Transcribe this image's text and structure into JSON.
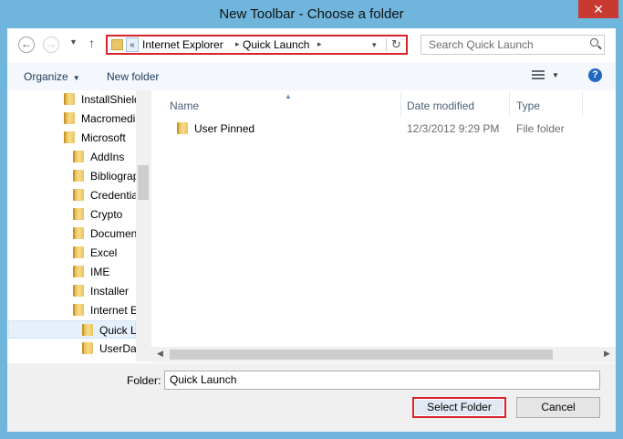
{
  "window": {
    "title": "New Toolbar - Choose a folder",
    "close_glyph": "✕"
  },
  "nav": {
    "back_glyph": "←",
    "forward_glyph": "→",
    "recent_glyph": "▼",
    "up_glyph": "↑"
  },
  "address": {
    "more_glyph": "«",
    "crumbs": [
      "Internet Explorer",
      "Quick Launch"
    ],
    "sep_glyph": "▸",
    "drop_glyph": "▾",
    "refresh_glyph": "↻"
  },
  "search": {
    "placeholder": "Search Quick Launch"
  },
  "commands": {
    "organize": "Organize",
    "new_folder": "New folder",
    "caret": "▼"
  },
  "tree": {
    "items": [
      {
        "label": "InstallShield"
      },
      {
        "label": "Macromedia"
      },
      {
        "label": "Microsoft"
      },
      {
        "label": "AddIns"
      },
      {
        "label": "Bibliography"
      },
      {
        "label": "Credentials"
      },
      {
        "label": "Crypto"
      },
      {
        "label": "Documents"
      },
      {
        "label": "Excel"
      },
      {
        "label": "IME"
      },
      {
        "label": "Installer"
      },
      {
        "label": "Internet Explorer"
      },
      {
        "label": "Quick Launch"
      },
      {
        "label": "UserData"
      }
    ]
  },
  "list": {
    "columns": {
      "name": "Name",
      "date": "Date modified",
      "type": "Type",
      "sort_glyph": "▲"
    },
    "rows": [
      {
        "name": "User Pinned",
        "date": "12/3/2012 9:29 PM",
        "type": "File folder"
      }
    ]
  },
  "scroll": {
    "left_glyph": "◀",
    "right_glyph": "▶"
  },
  "bottom": {
    "folder_label": "Folder:",
    "folder_value": "Quick Launch",
    "select_label": "Select Folder",
    "cancel_label": "Cancel"
  },
  "colors": {
    "accent_highlight": "#d8232a",
    "window_frame": "#6fb5dc",
    "folder": "#e9c66a"
  }
}
